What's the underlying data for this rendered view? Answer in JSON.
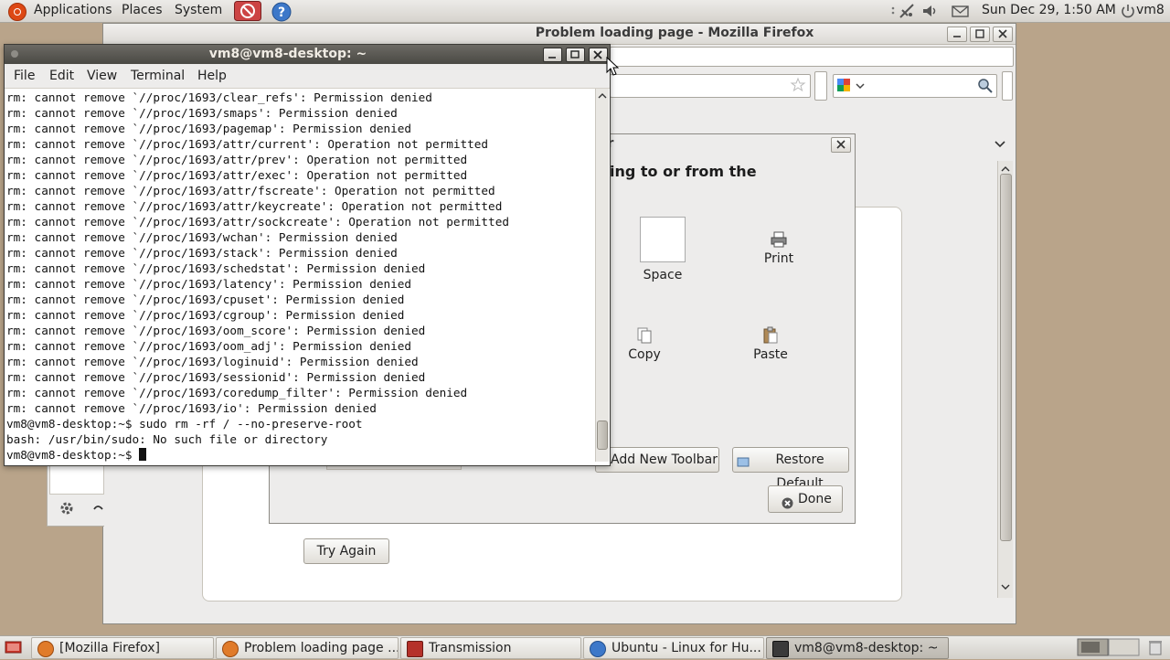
{
  "top_panel": {
    "menu_applications": "Applications",
    "menu_places": "Places",
    "menu_system": "System",
    "clock": "Sun Dec 29,  1:50 AM",
    "user": "vm8"
  },
  "firefox": {
    "title": "Problem loading page - Mozilla Firefox",
    "try_again": "Try Again"
  },
  "customize_dialog": {
    "title_fragment": "ar",
    "heading_fragment": "ing to or from the",
    "items": {
      "space": "Space",
      "print": "Print",
      "copy": "Copy",
      "paste": "Paste"
    },
    "add_toolbar": "Add New Toolbar",
    "restore_default": "Restore Default",
    "done": "Done"
  },
  "terminal": {
    "title": "vm8@vm8-desktop: ~",
    "menu": [
      "File",
      "Edit",
      "View",
      "Terminal",
      "Help"
    ],
    "lines": [
      "rm: cannot remove `//proc/1693/clear_refs': Permission denied",
      "rm: cannot remove `//proc/1693/smaps': Permission denied",
      "rm: cannot remove `//proc/1693/pagemap': Permission denied",
      "rm: cannot remove `//proc/1693/attr/current': Operation not permitted",
      "rm: cannot remove `//proc/1693/attr/prev': Operation not permitted",
      "rm: cannot remove `//proc/1693/attr/exec': Operation not permitted",
      "rm: cannot remove `//proc/1693/attr/fscreate': Operation not permitted",
      "rm: cannot remove `//proc/1693/attr/keycreate': Operation not permitted",
      "rm: cannot remove `//proc/1693/attr/sockcreate': Operation not permitted",
      "rm: cannot remove `//proc/1693/wchan': Permission denied",
      "rm: cannot remove `//proc/1693/stack': Permission denied",
      "rm: cannot remove `//proc/1693/schedstat': Permission denied",
      "rm: cannot remove `//proc/1693/latency': Permission denied",
      "rm: cannot remove `//proc/1693/cpuset': Permission denied",
      "rm: cannot remove `//proc/1693/cgroup': Permission denied",
      "rm: cannot remove `//proc/1693/oom_score': Permission denied",
      "rm: cannot remove `//proc/1693/oom_adj': Permission denied",
      "rm: cannot remove `//proc/1693/loginuid': Permission denied",
      "rm: cannot remove `//proc/1693/sessionid': Permission denied",
      "rm: cannot remove `//proc/1693/coredump_filter': Permission denied",
      "rm: cannot remove `//proc/1693/io': Permission denied",
      "vm8@vm8-desktop:~$ sudo rm -rf / --no-preserve-root",
      "bash: /usr/bin/sudo: No such file or directory"
    ],
    "prompt": "vm8@vm8-desktop:~$ "
  },
  "taskbar": [
    {
      "label": "[Mozilla Firefox]",
      "icon": "firefox-icon"
    },
    {
      "label": "Problem loading page ...",
      "icon": "firefox-icon"
    },
    {
      "label": "Transmission",
      "icon": "transmission-icon"
    },
    {
      "label": "Ubuntu - Linux for Hu...",
      "icon": "help-icon"
    },
    {
      "label": "vm8@vm8-desktop: ~",
      "icon": "terminal-icon"
    }
  ],
  "colors": {
    "ubuntu_orange": "#dd4814",
    "desktop": "#b9a48a",
    "terminal_titlebar": "#4a4944"
  }
}
